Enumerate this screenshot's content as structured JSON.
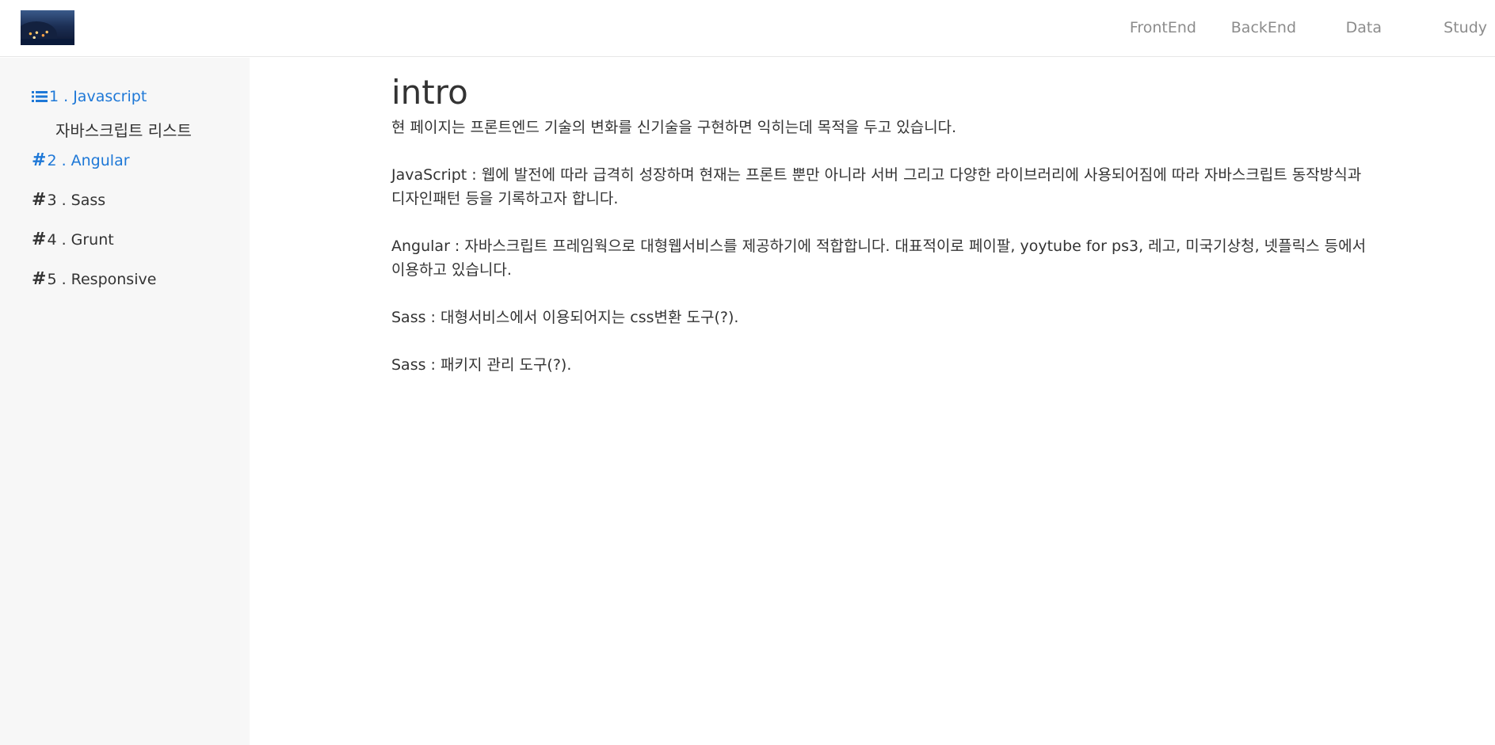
{
  "header": {
    "nav": [
      "FrontEnd",
      "BackEnd",
      "Data",
      "Study"
    ]
  },
  "sidebar": {
    "items": [
      {
        "num": "1 . Javascript",
        "sub": "자바스크립트 리스트"
      },
      {
        "num": "2 . Angular"
      },
      {
        "num": "3 . Sass"
      },
      {
        "num": "4 . Grunt"
      },
      {
        "num": "5 . Responsive"
      }
    ]
  },
  "main": {
    "title": "intro",
    "paragraphs": [
      "현 페이지는 프론트엔드 기술의 변화를 신기술을 구현하면 익히는데 목적을 두고 있습니다.",
      "JavaScript : 웹에 발전에 따라 급격히 성장하며 현재는 프론트 뿐만 아니라 서버 그리고 다양한 라이브러리에 사용되어짐에 따라 자바스크립트 동작방식과 디자인패턴 등을 기록하고자 합니다.",
      "Angular : 자바스크립트 프레임웍으로 대형웹서비스를 제공하기에 적합합니다. 대표적이로 페이팔, yoytube for ps3, 레고, 미국기상청, 넷플릭스 등에서 이용하고 있습니다.",
      "Sass : 대형서비스에서 이용되어지는 css변환 도구(?).",
      "Sass : 패키지 관리 도구(?)."
    ]
  },
  "colors": {
    "accent": "#1e78d7",
    "sidebar_bg": "#f7f7f7",
    "nav_text": "#8c8c8c"
  }
}
